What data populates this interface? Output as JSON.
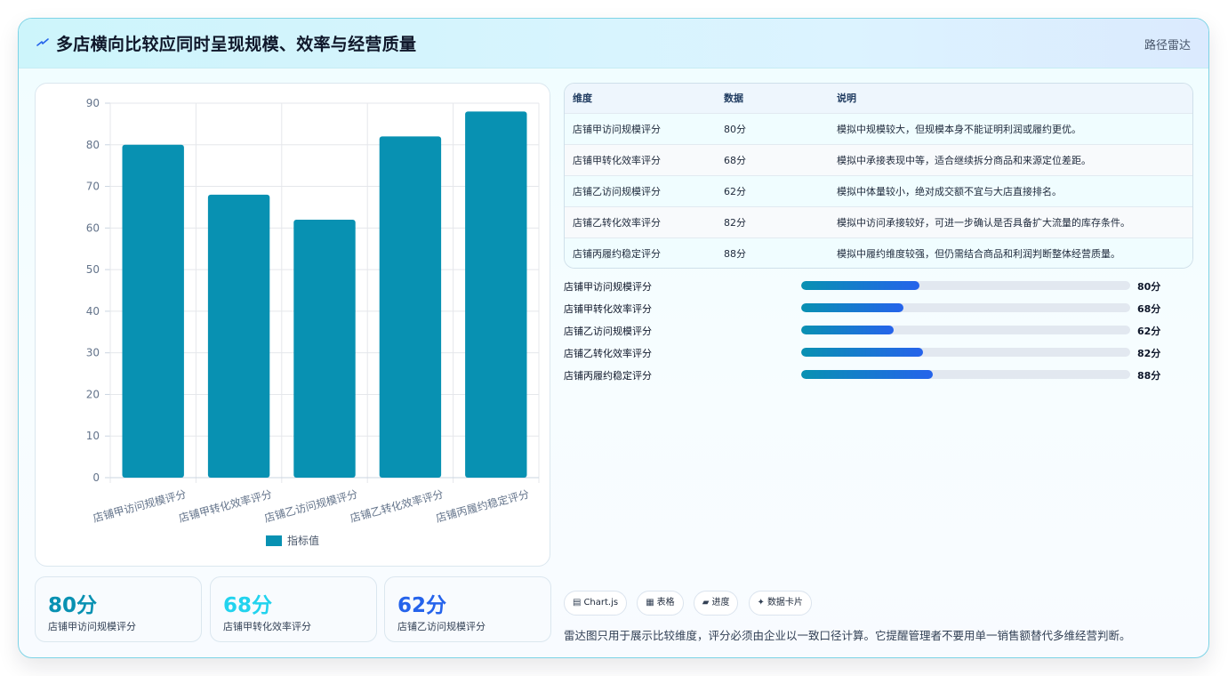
{
  "header": {
    "title": "多店横向比较应同时呈现规模、效率与经营质量",
    "tag": "路径雷达",
    "icon": "lightning-icon"
  },
  "chart_data": {
    "type": "bar",
    "categories": [
      "店铺甲访问规模评分",
      "店铺甲转化效率评分",
      "店铺乙访问规模评分",
      "店铺乙转化效率评分",
      "店铺丙履约稳定评分"
    ],
    "series": [
      {
        "name": "指标值",
        "values": [
          80,
          68,
          62,
          82,
          88
        ],
        "color": "#0891b2"
      }
    ],
    "ylim": [
      0,
      90
    ],
    "yticks": [
      0,
      10,
      20,
      30,
      40,
      50,
      60,
      70,
      80,
      90
    ],
    "legend": "bottom",
    "grid": true
  },
  "kpis": [
    {
      "value": "80分",
      "label": "店铺甲访问规模评分",
      "color": "#0891b2"
    },
    {
      "value": "68分",
      "label": "店铺甲转化效率评分",
      "color": "#22d3ee"
    },
    {
      "value": "62分",
      "label": "店铺乙访问规模评分",
      "color": "#2563eb"
    }
  ],
  "table": {
    "headers": [
      "维度",
      "数据",
      "说明"
    ],
    "rows": [
      [
        "店铺甲访问规模评分",
        "80分",
        "模拟中规模较大，但规模本身不能证明利润或履约更优。"
      ],
      [
        "店铺甲转化效率评分",
        "68分",
        "模拟中承接表现中等，适合继续拆分商品和来源定位差距。"
      ],
      [
        "店铺乙访问规模评分",
        "62分",
        "模拟中体量较小，绝对成交额不宜与大店直接排名。"
      ],
      [
        "店铺乙转化效率评分",
        "82分",
        "模拟中访问承接较好，可进一步确认是否具备扩大流量的库存条件。"
      ],
      [
        "店铺丙履约稳定评分",
        "88分",
        "模拟中履约维度较强，但仍需结合商品和利润判断整体经营质量。"
      ]
    ]
  },
  "progress": [
    {
      "label": "店铺甲访问规模评分",
      "value": "80分",
      "fraction": 0.36
    },
    {
      "label": "店铺甲转化效率评分",
      "value": "68分",
      "fraction": 0.31
    },
    {
      "label": "店铺乙访问规模评分",
      "value": "62分",
      "fraction": 0.28
    },
    {
      "label": "店铺乙转化效率评分",
      "value": "82分",
      "fraction": 0.37
    },
    {
      "label": "店铺丙履约稳定评分",
      "value": "88分",
      "fraction": 0.4
    }
  ],
  "chips": [
    {
      "icon": "▤",
      "icon_name": "chart-icon",
      "label": "Chart.js"
    },
    {
      "icon": "▦",
      "icon_name": "table-icon",
      "label": "表格"
    },
    {
      "icon": "▰",
      "icon_name": "progress-icon",
      "label": "进度"
    },
    {
      "icon": "✦",
      "icon_name": "sparkle-icon",
      "label": "数据卡片"
    }
  ],
  "note": "雷达图只用于展示比较维度，评分必须由企业以一致口径计算。它提醒管理者不要用单一销售额替代多维经营判断。"
}
